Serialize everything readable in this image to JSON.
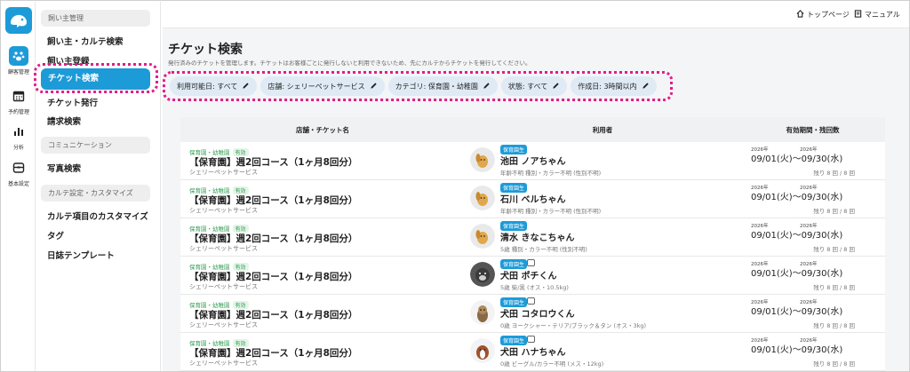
{
  "rail": [
    {
      "label": "顧客管理",
      "icon": "pet-icon",
      "active": true
    },
    {
      "label": "予約管理",
      "icon": "calendar-icon",
      "active": false
    },
    {
      "label": "分析",
      "icon": "bar-chart-icon",
      "active": false
    },
    {
      "label": "基本設定",
      "icon": "settings-box-icon",
      "active": false
    }
  ],
  "menu": {
    "section1": "飼い主管理",
    "item_owner_karte": "飼い主・カルテ検索",
    "item_owner_register": "飼い主登録",
    "item_ticket_search": "チケット検索",
    "item_ticket_issue": "チケット発行",
    "item_billing": "請求検索",
    "section2": "コミュニケーション",
    "item_photo": "写真検索",
    "section3": "カルテ設定・カスタマイズ",
    "item_karte_custom": "カルテ項目のカスタマイズ",
    "item_tag": "タグ",
    "item_diary": "日誌テンプレート"
  },
  "topbar": {
    "top_page": "トップページ",
    "manual": "マニュアル"
  },
  "page": {
    "title": "チケット検索",
    "description": "発行済みのチケットを管理します。チケットはお客様ごとに発行しないと利用できないため、先にカルテからチケットを発行してください。"
  },
  "filters": [
    "利用可能日: すべて",
    "店舗: シェリーペットサービス",
    "カテゴリ: 保育園・幼稚園",
    "状態: すべて",
    "作成日: 3時間以内"
  ],
  "table": {
    "headers": {
      "ticket": "店舗・チケット名",
      "user": "利用者",
      "period": "有効期間・残回数"
    },
    "rows": [
      {
        "category": "保育園・幼稚園",
        "status": "有効",
        "ticket": "【保育園】週2回コース（1ヶ月8回分）",
        "shop": "シェリーペットサービス",
        "badge": "保育園生",
        "name": "池田 ノアちゃん",
        "detail": "年齢不明 種別・カラー不明 (性別不明)",
        "year_start": "2026年",
        "year_end": "2026年",
        "dates": "09/01(火)〜09/30(水)",
        "remain": "残り 8 回 / 8 回",
        "avatar": "dog-placeholder-icon"
      },
      {
        "category": "保育園・幼稚園",
        "status": "有効",
        "ticket": "【保育園】週2回コース（1ヶ月8回分）",
        "shop": "シェリーペットサービス",
        "badge": "保育園生",
        "name": "石川 ベルちゃん",
        "detail": "年齢不明 種別・カラー不明 (性別不明)",
        "year_start": "2026年",
        "year_end": "2026年",
        "dates": "09/01(火)〜09/30(水)",
        "remain": "残り 8 回 / 8 回",
        "avatar": "dog-placeholder-icon"
      },
      {
        "category": "保育園・幼稚園",
        "status": "有効",
        "ticket": "【保育園】週2回コース（1ヶ月8回分）",
        "shop": "シェリーペットサービス",
        "badge": "保育園生",
        "name": "清水 きなこちゃん",
        "detail": "5歳 種別・カラー不明 (性別不明)",
        "year_start": "2026年",
        "year_end": "2026年",
        "dates": "09/01(火)〜09/30(水)",
        "remain": "残り 8 回 / 8 回",
        "avatar": "dog-placeholder-icon"
      },
      {
        "category": "保育園・幼稚園",
        "status": "有効",
        "ticket": "【保育園】週2回コース（1ヶ月8回分）",
        "shop": "シェリーペットサービス",
        "badge": "保育園生",
        "name": "犬田 ポチくん",
        "detail": "5歳 柴/黒 (オス・10.5kg)",
        "year_start": "2026年",
        "year_end": "2026年",
        "dates": "09/01(火)〜09/30(水)",
        "remain": "残り 8 回 / 8 回",
        "avatar": "dog-photo-icon"
      },
      {
        "category": "保育園・幼稚園",
        "status": "有効",
        "ticket": "【保育園】週2回コース（1ヶ月8回分）",
        "shop": "シェリーペットサービス",
        "badge": "保育園生",
        "name": "犬田 コタロウくん",
        "detail": "0歳 ヨークシャー・テリア/ブラック＆タン (オス・3kg)",
        "year_start": "2026年",
        "year_end": "2026年",
        "dates": "09/01(火)〜09/30(水)",
        "remain": "残り 8 回 / 8 回",
        "avatar": "dog-photo-icon"
      },
      {
        "category": "保育園・幼稚園",
        "status": "有効",
        "ticket": "【保育園】週2回コース（1ヶ月8回分）",
        "shop": "シェリーペットサービス",
        "badge": "保育園生",
        "name": "犬田 ハナちゃん",
        "detail": "0歳 ビーグル/カラー不明 (メス・12kg)",
        "year_start": "2026年",
        "year_end": "2026年",
        "dates": "09/01(火)〜09/30(水)",
        "remain": "残り 8 回 / 8 回",
        "avatar": "dog-photo-icon"
      }
    ]
  },
  "colors": {
    "accent": "#1d9bd8",
    "highlight": "#e11d8a",
    "chip_bg": "#dfeaf5",
    "status_green": "#2e9e4f"
  }
}
